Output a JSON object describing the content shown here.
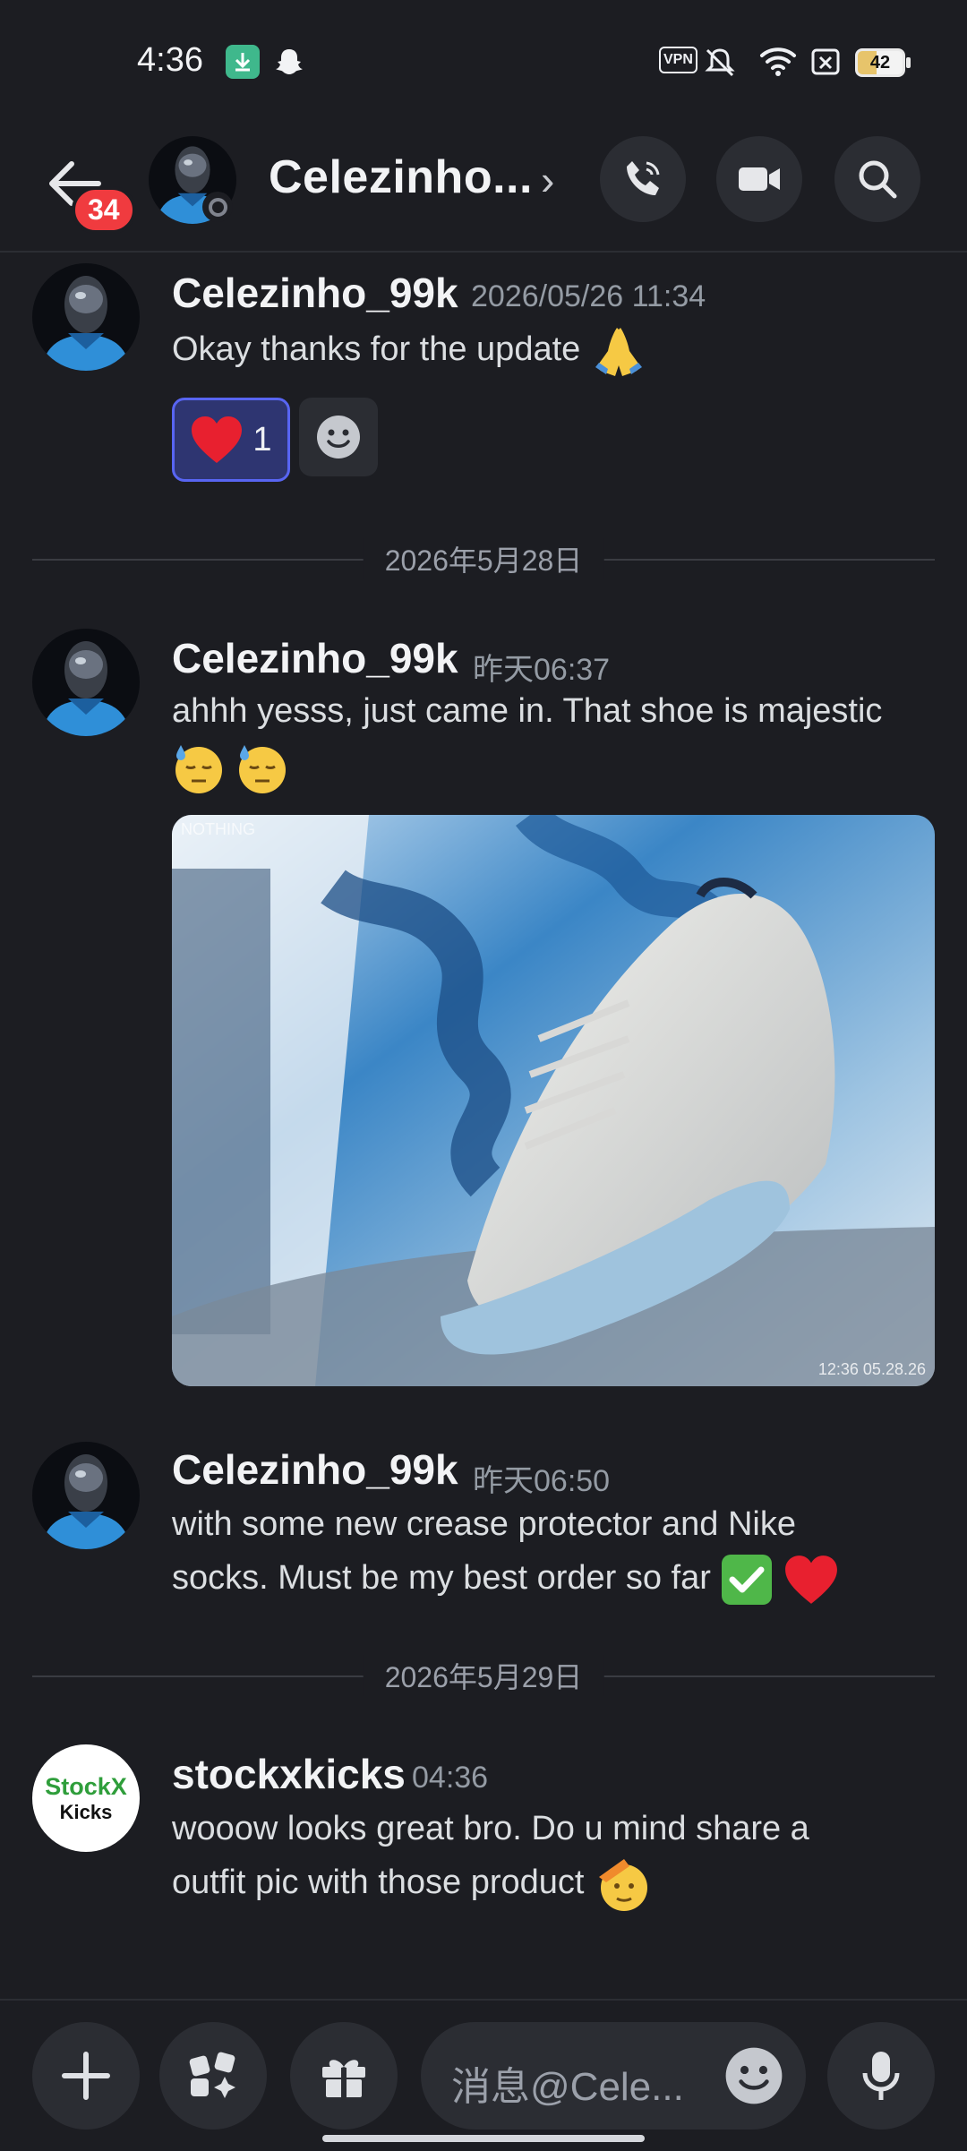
{
  "status_bar": {
    "time": "4:36",
    "vpn": "VPN",
    "battery": "42"
  },
  "header": {
    "back_badge": "34",
    "title": "Celezinho...",
    "chevron": "›"
  },
  "messages": [
    {
      "username": "Celezinho_99k",
      "timestamp": "2026/05/26 11:34",
      "text": "Okay thanks for the update",
      "reaction_count": "1"
    },
    {
      "username": "Celezinho_99k",
      "timestamp": "昨天06:37",
      "text": "ahhh yesss, just came in. That shoe is majestic",
      "photo_watermark_left": "NOTHING",
      "photo_timestamp": "12:36 05.28.26"
    },
    {
      "username": "Celezinho_99k",
      "timestamp": "昨天06:50",
      "text_line1": "with some new crease protector and Nike",
      "text_line2": "socks. Must be my best order so far"
    },
    {
      "username": "stockxkicks",
      "timestamp": "04:36",
      "avatar_line1": "StockX",
      "avatar_line2": "Kicks",
      "text_line1": "wooow looks great bro. Do u mind share a",
      "text_line2": "outfit pic with those product"
    }
  ],
  "dividers": [
    "2026年5月28日",
    "2026年5月29日"
  ],
  "composer": {
    "placeholder": "消息@Cele..."
  },
  "colors": {
    "background": "#1c1d22",
    "surface": "#2b2d33",
    "badge": "#f03b3f",
    "accent": "#5865f2"
  }
}
